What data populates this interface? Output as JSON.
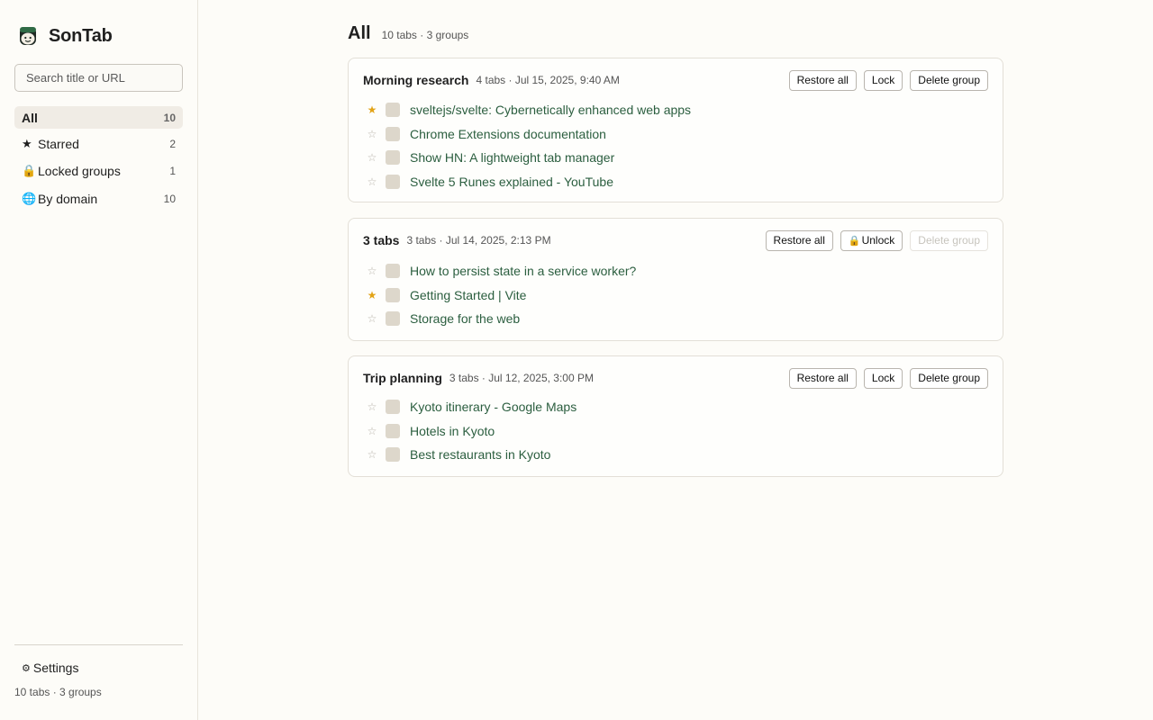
{
  "app": {
    "name": "SonTab"
  },
  "search": {
    "placeholder": "Search title or URL"
  },
  "nav": [
    {
      "icon": "",
      "label": "All",
      "count": "10",
      "active": true
    },
    {
      "icon": "★",
      "label": "Starred",
      "count": "2",
      "active": false
    },
    {
      "icon": "🔒",
      "label": "Locked groups",
      "count": "1",
      "active": false
    },
    {
      "icon": "🌐",
      "label": "By domain",
      "count": "10",
      "active": false
    }
  ],
  "settings": {
    "icon": "⚙",
    "label": "Settings"
  },
  "footer": {
    "summary": "10 tabs · 3 groups"
  },
  "main": {
    "title": "All",
    "meta": "10 tabs · 3 groups"
  },
  "groups": [
    {
      "title": "Morning research",
      "meta": "4 tabs · Jul 15, 2025, 9:40 AM",
      "restore_label": "Restore all",
      "lock_label": "Lock",
      "locked": false,
      "delete_label": "Delete group",
      "tabs": [
        {
          "title": "sveltejs/svelte: Cybernetically enhanced web apps",
          "starred": true
        },
        {
          "title": "Chrome Extensions documentation",
          "starred": false
        },
        {
          "title": "Show HN: A lightweight tab manager",
          "starred": false
        },
        {
          "title": "Svelte 5 Runes explained - YouTube",
          "starred": false
        }
      ]
    },
    {
      "title": "3 tabs",
      "meta": "3 tabs · Jul 14, 2025, 2:13 PM",
      "restore_label": "Restore all",
      "lock_label": "Unlock",
      "locked": true,
      "delete_label": "Delete group",
      "tabs": [
        {
          "title": "How to persist state in a service worker?",
          "starred": false
        },
        {
          "title": "Getting Started | Vite",
          "starred": true
        },
        {
          "title": "Storage for the web",
          "starred": false
        }
      ]
    },
    {
      "title": "Trip planning",
      "meta": "3 tabs · Jul 12, 2025, 3:00 PM",
      "restore_label": "Restore all",
      "lock_label": "Lock",
      "locked": false,
      "delete_label": "Delete group",
      "tabs": [
        {
          "title": "Kyoto itinerary - Google Maps",
          "starred": false
        },
        {
          "title": "Hotels in Kyoto",
          "starred": false
        },
        {
          "title": "Best restaurants in Kyoto",
          "starred": false
        }
      ]
    }
  ]
}
